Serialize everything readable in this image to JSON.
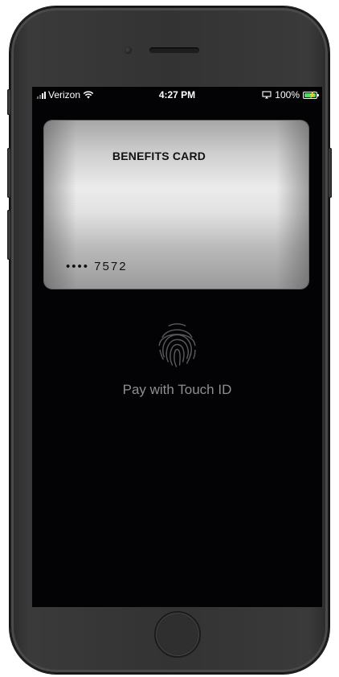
{
  "status_bar": {
    "carrier": "Verizon",
    "time": "4:27 PM",
    "battery_percent": "100%",
    "icons": [
      "signal-icon",
      "wifi-icon",
      "screen-mirroring-icon",
      "battery-charging-icon"
    ]
  },
  "card": {
    "title": "BENEFITS CARD",
    "number_masked": "•••• 7572"
  },
  "touch_id": {
    "icon": "fingerprint-icon",
    "label": "Pay with Touch ID"
  },
  "colors": {
    "screen_bg": "#030305",
    "label_gray": "#8e8e93",
    "battery_green": "#4cd964"
  }
}
